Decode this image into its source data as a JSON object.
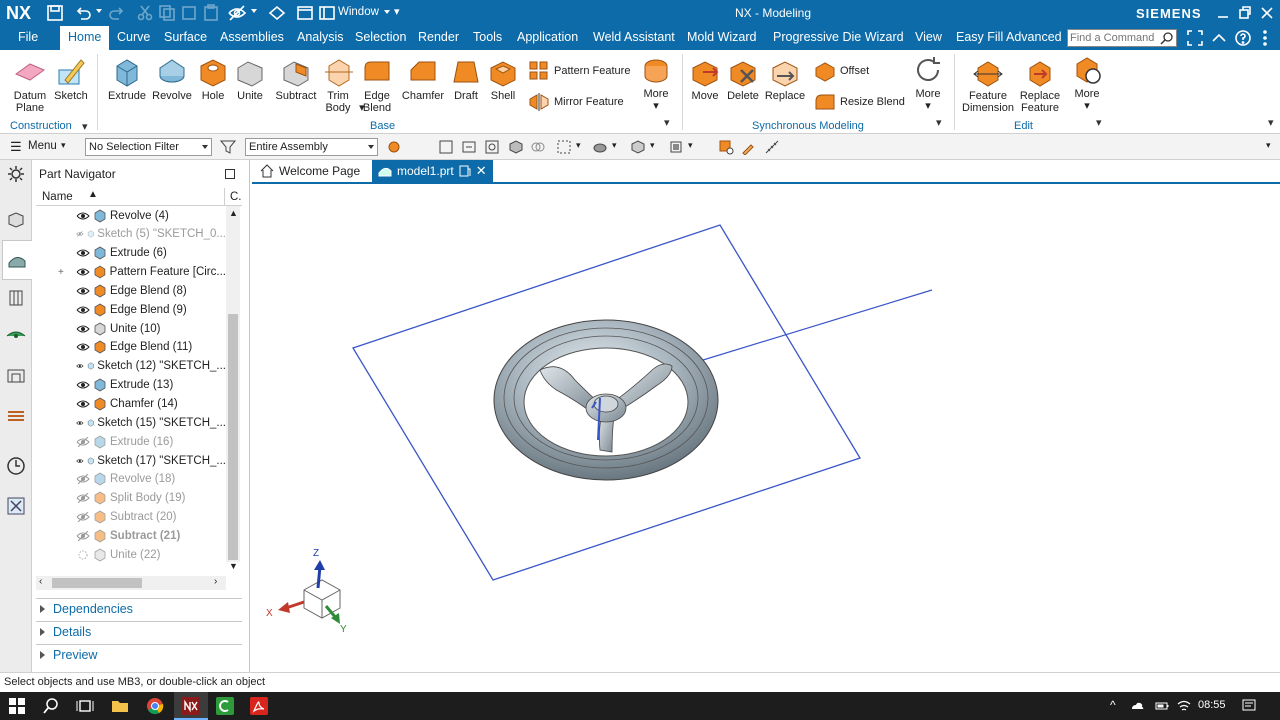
{
  "app": {
    "logo": "NX",
    "title": "NX - Modeling",
    "brand": "SIEMENS",
    "window_menu": "Window"
  },
  "menu": {
    "items": [
      "File",
      "Home",
      "Curve",
      "Surface",
      "Assemblies",
      "Analysis",
      "Selection",
      "Render",
      "Tools",
      "Application",
      "Weld Assistant",
      "Mold Wizard",
      "Progressive Die Wizard",
      "View",
      "Easy Fill Advanced"
    ],
    "active": "Home",
    "search_placeholder": "Find a Command"
  },
  "ribbon": {
    "datum_plane": "Datum Plane",
    "sketch": "Sketch",
    "extrude": "Extrude",
    "revolve": "Revolve",
    "hole": "Hole",
    "unite": "Unite",
    "subtract": "Subtract",
    "trim_body": "Trim Body",
    "edge_blend": "Edge Blend",
    "chamfer": "Chamfer",
    "draft": "Draft",
    "shell": "Shell",
    "pattern_feature": "Pattern Feature",
    "mirror_feature": "Mirror Feature",
    "more": "More",
    "move": "Move",
    "delete": "Delete",
    "replace": "Replace",
    "offset": "Offset",
    "resize_blend": "Resize Blend",
    "feature_dimension": "Feature Dimension",
    "replace_feature": "Replace Feature",
    "groups": {
      "construction": "Construction",
      "base": "Base",
      "synchronous": "Synchronous Modeling",
      "edit": "Edit"
    }
  },
  "selbar": {
    "menu": "Menu",
    "filter": "No Selection Filter",
    "scope": "Entire Assembly"
  },
  "navigator": {
    "title": "Part Navigator",
    "col_name": "Name",
    "col_c": "C.",
    "rows": [
      {
        "label": "Revolve (4)",
        "type": "revolve",
        "state": "normal"
      },
      {
        "label": "Sketch (5) \"SKETCH_0...",
        "type": "sketch",
        "state": "dim"
      },
      {
        "label": "Extrude (6)",
        "type": "extrude",
        "state": "normal"
      },
      {
        "label": "Pattern Feature [Circ...",
        "type": "pattern",
        "state": "normal"
      },
      {
        "label": "Edge Blend (8)",
        "type": "blend",
        "state": "normal"
      },
      {
        "label": "Edge Blend (9)",
        "type": "blend",
        "state": "normal"
      },
      {
        "label": "Unite (10)",
        "type": "unite",
        "state": "normal"
      },
      {
        "label": "Edge Blend (11)",
        "type": "blend",
        "state": "normal"
      },
      {
        "label": "Sketch (12) \"SKETCH_...",
        "type": "sketch",
        "state": "normal"
      },
      {
        "label": "Extrude (13)",
        "type": "extrude",
        "state": "normal"
      },
      {
        "label": "Chamfer (14)",
        "type": "blend",
        "state": "normal"
      },
      {
        "label": "Sketch (15) \"SKETCH_...",
        "type": "sketch",
        "state": "normal"
      },
      {
        "label": "Extrude (16)",
        "type": "extrude",
        "state": "dim"
      },
      {
        "label": "Sketch (17) \"SKETCH_...",
        "type": "sketch",
        "state": "normal"
      },
      {
        "label": "Revolve (18)",
        "type": "revolve",
        "state": "dim"
      },
      {
        "label": "Split Body (19)",
        "type": "blend",
        "state": "dim"
      },
      {
        "label": "Subtract (20)",
        "type": "subtract",
        "state": "dim"
      },
      {
        "label": "Subtract (21)",
        "type": "subtract",
        "state": "dimbold"
      },
      {
        "label": "Unite (22)",
        "type": "unite",
        "state": "dim"
      }
    ],
    "accordion": [
      "Dependencies",
      "Details",
      "Preview"
    ]
  },
  "tabs": {
    "welcome": "Welcome Page",
    "model": "model1.prt"
  },
  "axes": {
    "x": "X",
    "y": "Y",
    "z": "Z"
  },
  "status": "Select objects and use MB3, or double-click an object",
  "taskbar": {
    "time": "08:55"
  },
  "colors": {
    "accent": "#0c6ba8",
    "feature_orange": "#f08a24",
    "plane_blue": "#3a55c8"
  }
}
